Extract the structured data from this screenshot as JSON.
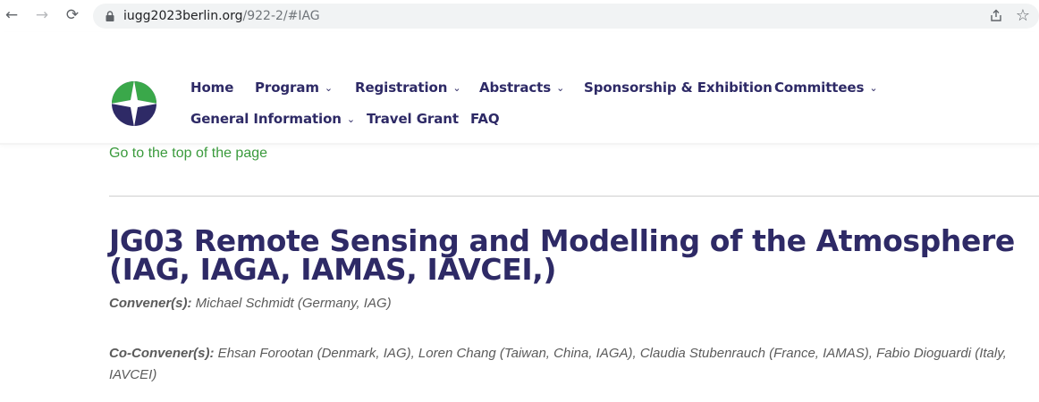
{
  "browser": {
    "url_domain": "iugg2023berlin.org",
    "url_path": "/922-2/#IAG",
    "icons": [
      "back-arrow-icon",
      "forward-arrow-icon",
      "reload-icon",
      "lock-icon",
      "share-icon",
      "star-icon"
    ]
  },
  "nav": {
    "home": "Home",
    "program": "Program",
    "registration": "Registration",
    "abstracts": "Abstracts",
    "sponsorship": "Sponsorship & Exhibition",
    "committees": "Committees",
    "general_information": "General Information",
    "travel_grant": "Travel Grant",
    "faq": "FAQ",
    "chevron": "⌄"
  },
  "content": {
    "top_link": "Go to the top of the page",
    "title": "JG03 Remote Sensing and Modelling of the Atmosphere (IAG, IAGA, IAMAS, IAVCEI,)",
    "conveners_label": "Convener(s):",
    "conveners_value": " Michael Schmidt (Germany, IAG)",
    "coconveners_label": "Co-Convener(s):",
    "coconveners_value": " Ehsan Forootan (Denmark, IAG), Loren Chang (Taiwan, China, IAGA), Claudia Stubenrauch (France, IAMAS), Fabio Dioguardi (Italy, IAVCEI)"
  },
  "colors": {
    "brand_navy": "#2e2a66",
    "link_green": "#3a9a3c",
    "logo_green": "#3aa84a"
  }
}
